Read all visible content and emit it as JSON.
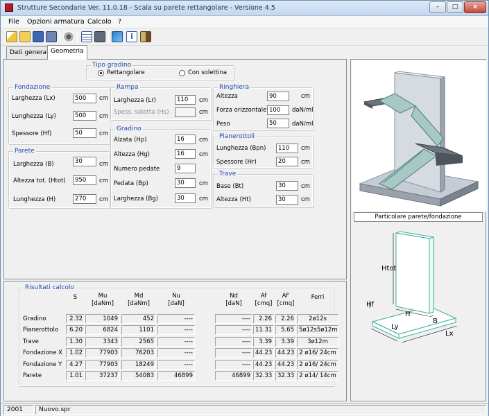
{
  "window": {
    "title": "Strutture Secondarie Ver. 11.0.18 - Scala su parete rettangolare - Versione 4.5",
    "min": "–",
    "max": "□",
    "close": "x"
  },
  "menu": [
    "File",
    "Opzioni armatura",
    "Calcolo",
    "?"
  ],
  "tabs": [
    "Dati generali",
    "Geometria"
  ],
  "tipo_gradino": {
    "title": "Tipo gradino",
    "opt1": "Rettangolare",
    "opt2": "Con solettina",
    "selected": "Rettangolare"
  },
  "fondazione": {
    "title": "Fondazione",
    "rows": [
      {
        "label": "Larghezza (Lx)",
        "value": "500",
        "unit": "cm"
      },
      {
        "label": "Lunghezza (Ly)",
        "value": "500",
        "unit": "cm"
      },
      {
        "label": "Spessore (Hf)",
        "value": "50",
        "unit": "cm"
      }
    ]
  },
  "parete": {
    "title": "Parete",
    "rows": [
      {
        "label": "Larghezza (B)",
        "value": "30",
        "unit": "cm"
      },
      {
        "label": "Altezza tot. (Htot)",
        "value": "950",
        "unit": "cm"
      },
      {
        "label": "Lunghezza (H)",
        "value": "270",
        "unit": "cm"
      }
    ]
  },
  "rampa": {
    "title": "Rampa",
    "rows": [
      {
        "label": "Larghezza (Lr)",
        "value": "110",
        "unit": "cm"
      },
      {
        "label": "Spess. soletta (Hs)",
        "value": "",
        "unit": "cm"
      }
    ]
  },
  "gradino": {
    "title": "Gradino",
    "rows": [
      {
        "label": "Alzata (Hp)",
        "value": "16",
        "unit": "cm"
      },
      {
        "label": "Altezza (Hg)",
        "value": "16",
        "unit": "cm"
      },
      {
        "label": "Numero pedate",
        "value": "9",
        "unit": ""
      },
      {
        "label": "Pedata (Bp)",
        "value": "30",
        "unit": "cm"
      },
      {
        "label": "Larghezza (Bg)",
        "value": "30",
        "unit": "cm"
      }
    ]
  },
  "ringhiera": {
    "title": "Ringhiera",
    "rows": [
      {
        "label": "Altezza",
        "value": "90",
        "unit": "cm"
      },
      {
        "label": "Forza orizzontale",
        "value": "100",
        "unit": "daN/ml"
      },
      {
        "label": "Peso",
        "value": "50",
        "unit": "daN/ml"
      }
    ]
  },
  "pianerottoli": {
    "title": "Pianerottoli",
    "rows": [
      {
        "label": "Lunghezza (Bpn)",
        "value": "110",
        "unit": "cm"
      },
      {
        "label": "Spessore (Hr)",
        "value": "20",
        "unit": "cm"
      }
    ]
  },
  "trave": {
    "title": "Trave",
    "rows": [
      {
        "label": "Base (Bt)",
        "value": "30",
        "unit": "cm"
      },
      {
        "label": "Altezza (Ht)",
        "value": "30",
        "unit": "cm"
      }
    ]
  },
  "risultati": {
    "title": "Risultati calcolo",
    "headers": [
      "S",
      "Mu\n[daNm]",
      "Md\n[daNm]",
      "Nu\n[daN]",
      "Nd\n[daN]",
      "Af\n[cmq]",
      "Af'\n[cmq]",
      "Ferri"
    ],
    "rows": [
      {
        "name": "Gradino",
        "cells": [
          "2.32",
          "1049",
          "452",
          "----",
          "----",
          "2.26",
          "2.26",
          "2ø12s"
        ]
      },
      {
        "name": "Pianerottolo",
        "cells": [
          "6.20",
          "6824",
          "1101",
          "----",
          "----",
          "11.31",
          "5.65",
          "5ø12s5ø12m"
        ]
      },
      {
        "name": "Trave",
        "cells": [
          "1.30",
          "3343",
          "2565",
          "----",
          "----",
          "3.39",
          "3.39",
          "3ø12m"
        ]
      },
      {
        "name": "Fondazione X",
        "cells": [
          "1.02",
          "77903",
          "76203",
          "----",
          "----",
          "44.23",
          "44.23",
          "2 ø16/ 24cm"
        ]
      },
      {
        "name": "Fondazione Y",
        "cells": [
          "4.27",
          "77903",
          "18249",
          "----",
          "----",
          "44.23",
          "44.23",
          "2 ø16/ 24cm"
        ]
      },
      {
        "name": "Parete",
        "cells": [
          "1.01",
          "37237",
          "54083",
          "46899",
          "46899",
          "32.33",
          "32.33",
          "2 ø14/ 14cm"
        ]
      }
    ]
  },
  "figure": {
    "caption": "Particolare parete/fondazione",
    "labels": {
      "htot": "Htot",
      "hf": "Hf",
      "h": "H",
      "b": "B",
      "ly": "Ly",
      "lx": "Lx"
    }
  },
  "status": {
    "year": "2001",
    "file": "Nuovo.spr"
  }
}
